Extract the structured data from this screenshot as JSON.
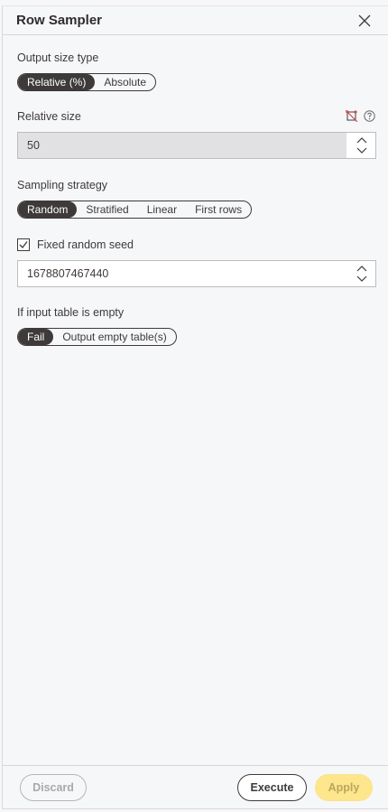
{
  "header": {
    "title": "Row Sampler",
    "close_icon": "close-icon"
  },
  "output_size_type": {
    "label": "Output size type",
    "options": [
      "Relative (%)",
      "Absolute"
    ],
    "selected": "Relative (%)"
  },
  "relative_size": {
    "label": "Relative size",
    "value": "50",
    "icons": [
      "flow-variable-icon",
      "help-icon"
    ],
    "icon_color": "#d14b4b"
  },
  "sampling_strategy": {
    "label": "Sampling strategy",
    "options": [
      "Random",
      "Stratified",
      "Linear",
      "First rows"
    ],
    "selected": "Random"
  },
  "fixed_seed": {
    "label": "Fixed random seed",
    "checked": true,
    "value": "1678807467440"
  },
  "empty_table": {
    "label": "If input table is empty",
    "options": [
      "Fail",
      "Output empty table(s)"
    ],
    "selected": "Fail"
  },
  "footer": {
    "discard_label": "Discard",
    "execute_label": "Execute",
    "apply_label": "Apply",
    "apply_color": "#fde68b"
  }
}
